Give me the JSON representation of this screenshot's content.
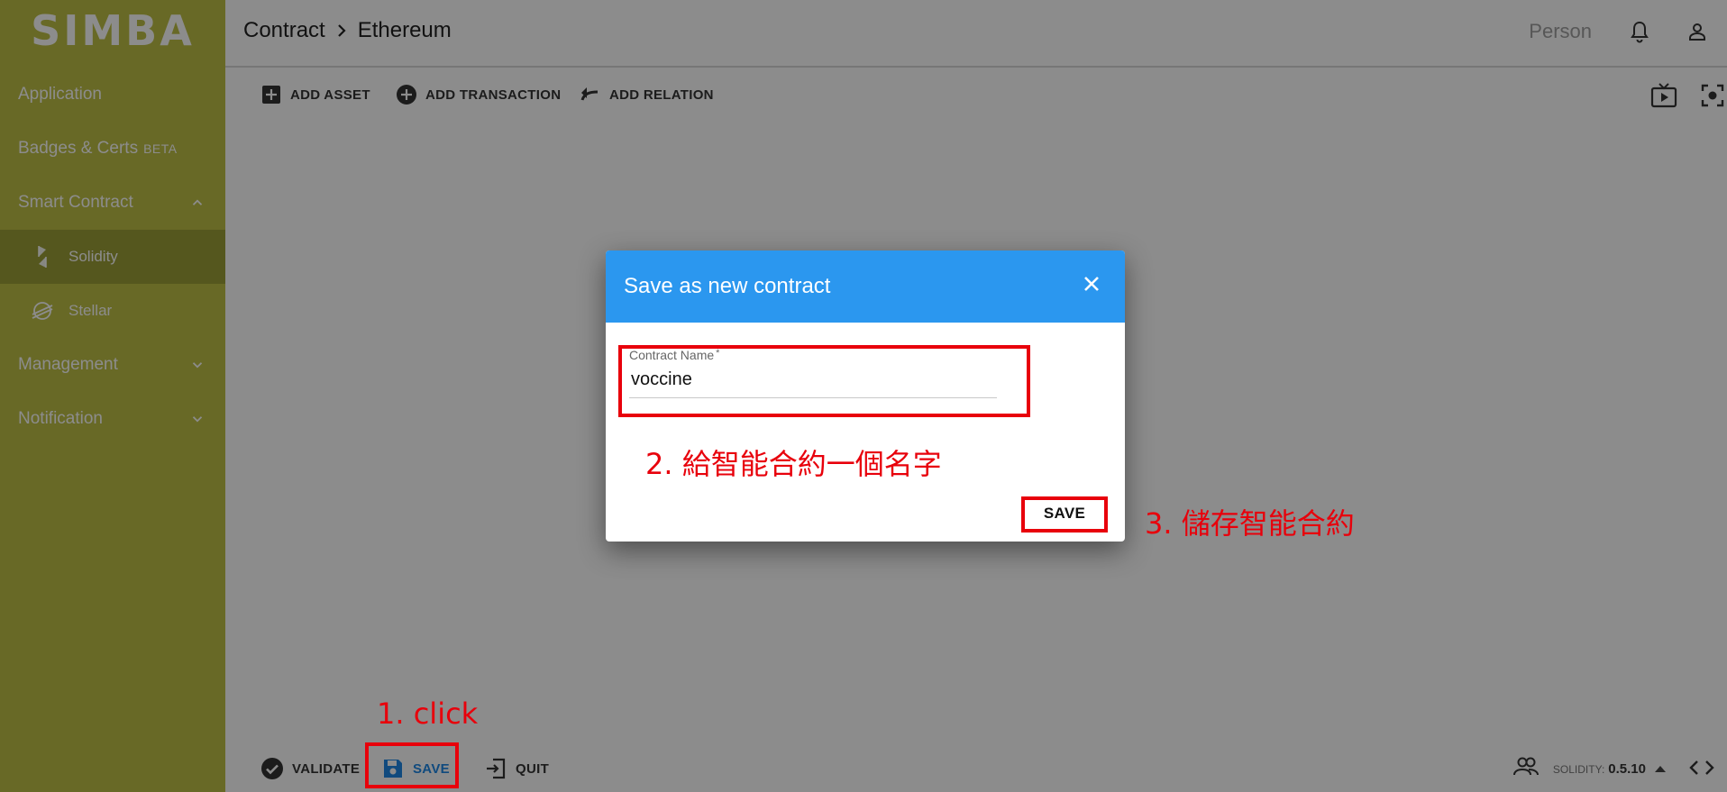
{
  "sidebar": {
    "logo": "SIMBA",
    "items": {
      "application": "Application",
      "badges": "Badges & Certs",
      "badges_tag": "BETA",
      "smart_contract": "Smart Contract",
      "solidity": "Solidity",
      "stellar": "Stellar",
      "management": "Management",
      "notification": "Notification"
    },
    "active_item": "Solidity",
    "colors": {
      "background": "#bec045",
      "active": "#9c9e38"
    }
  },
  "header": {
    "breadcrumb": [
      "Contract",
      "Ethereum"
    ],
    "user_label": "Person",
    "icons": [
      "bell-icon",
      "user-icon"
    ]
  },
  "toolbar": {
    "add_asset": "ADD ASSET",
    "add_transaction": "ADD TRANSACTION",
    "add_relation": "ADD RELATION",
    "right_icons": [
      "tv-play-icon",
      "focus-icon"
    ]
  },
  "bottombar": {
    "validate": "VALIDATE",
    "save": "SAVE",
    "quit": "QUIT",
    "solidity_label": "SOLIDITY:",
    "solidity_version": "0.5.10"
  },
  "dialog": {
    "title": "Save as new contract",
    "field_label": "Contract Name",
    "field_required_mark": "*",
    "field_value": "voccine",
    "save_label": "SAVE",
    "header_color": "#2b97ef"
  },
  "annotations": {
    "step1": "1. click",
    "step2": "2. 給智能合約一個名字",
    "step3": "3. 儲存智能合約",
    "color": "#e8000b"
  }
}
